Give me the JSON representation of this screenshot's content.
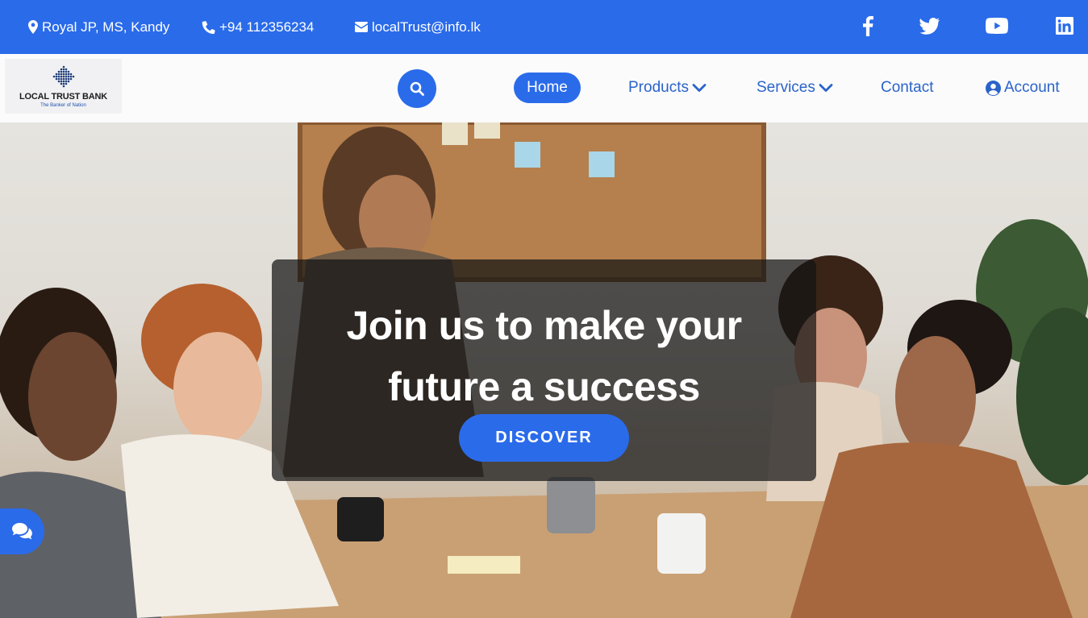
{
  "topbar": {
    "address": "Royal JP, MS, Kandy",
    "phone": "+94 112356234",
    "email": "localTrust@info.lk",
    "social_icons": [
      "facebook-icon",
      "twitter-icon",
      "youtube-icon",
      "linkedin-icon"
    ]
  },
  "logo": {
    "name": "LOCAL TRUST BANK",
    "tagline": "The Banker of Nation"
  },
  "nav": {
    "search_icon": "search-icon",
    "home": "Home",
    "products": "Products",
    "services": "Services",
    "contact": "Contact",
    "account": "Account"
  },
  "hero": {
    "title_line1": "Join us to make your",
    "title_line2": "future a success",
    "button": "DISCOVER"
  },
  "chat": {
    "icon": "chat-icon"
  },
  "colors": {
    "primary": "#2a6bea",
    "nav_text": "#2a63c9",
    "overlay": "rgba(20,20,20,0.72)",
    "white": "#ffffff"
  }
}
